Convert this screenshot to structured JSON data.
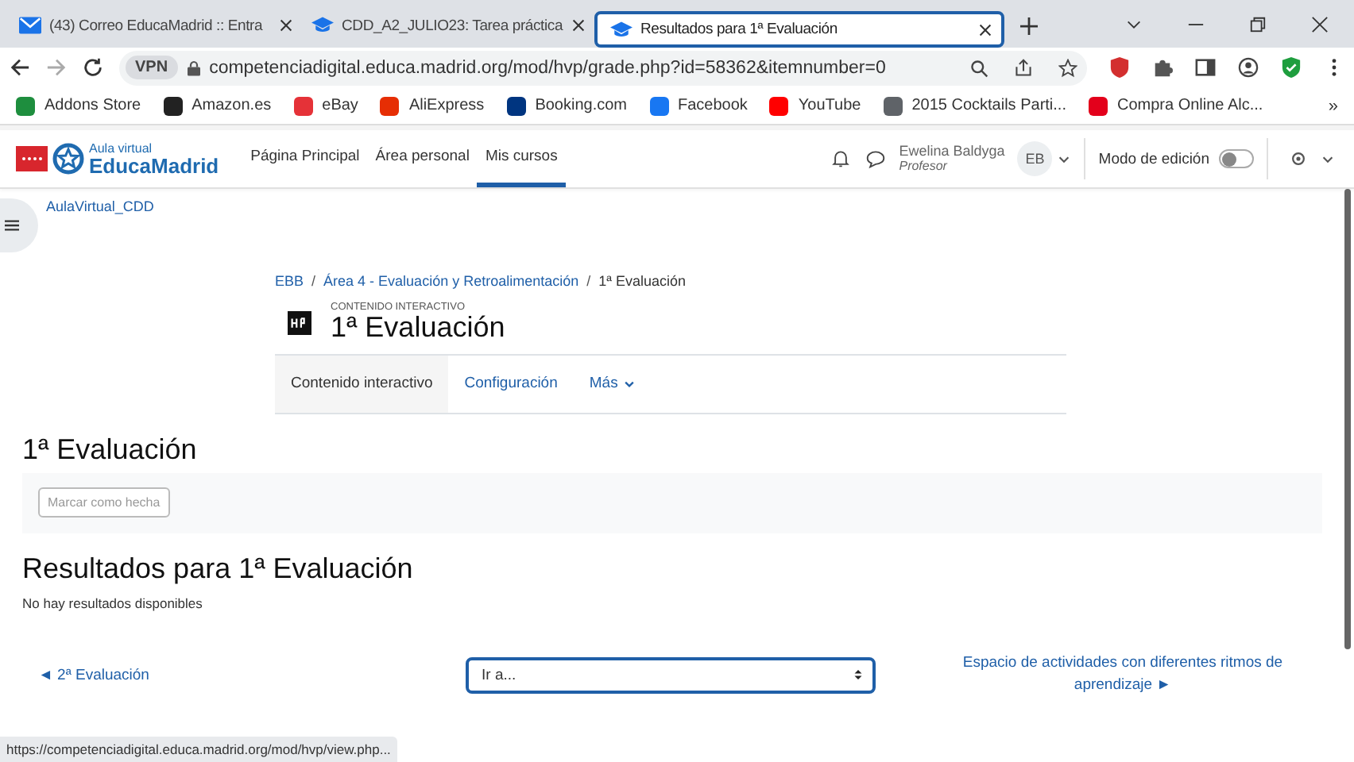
{
  "browser": {
    "tabs": [
      {
        "title": "(43) Correo EducaMadrid :: Entra",
        "selected": false
      },
      {
        "title": "CDD_A2_JULIO23: Tarea práctica",
        "selected": false
      },
      {
        "title": "Resultados para 1ª Evaluación",
        "selected": true
      }
    ],
    "vpn": "VPN",
    "url": "competenciadigital.educa.madrid.org/mod/hvp/grade.php?id=58362&itemnumber=0",
    "bookmarks": [
      {
        "label": "Addons Store",
        "color": "#1e8e3e"
      },
      {
        "label": "Amazon.es",
        "color": "#222222"
      },
      {
        "label": "eBay",
        "color": "#e53238"
      },
      {
        "label": "AliExpress",
        "color": "#e62e04"
      },
      {
        "label": "Booking.com",
        "color": "#003580"
      },
      {
        "label": "Facebook",
        "color": "#1877f2"
      },
      {
        "label": "YouTube",
        "color": "#ff0000"
      },
      {
        "label": "2015 Cocktails Parti...",
        "color": "#5f6368"
      },
      {
        "label": "Compra Online Alc...",
        "color": "#e3001b"
      }
    ],
    "more": "»"
  },
  "site": {
    "logo_small": "Aula virtual",
    "logo_big": "EducaMadrid",
    "nav": [
      {
        "label": "Página Principal",
        "selected": false
      },
      {
        "label": "Área personal",
        "selected": false
      },
      {
        "label": "Mis cursos",
        "selected": true
      }
    ],
    "user_name": "Ewelina Baldyga",
    "user_role": "Profesor",
    "initials": "EB",
    "edit_mode": "Modo de edición",
    "edit_on": false
  },
  "course_link": "AulaVirtual_CDD",
  "breadcrumb_separator": "/",
  "breadcrumb": [
    "EBB",
    "Área 4 - Evaluación y Retroalimentación",
    "1ª Evaluación"
  ],
  "activity": {
    "type": "CONTENIDO INTERACTIVO",
    "title": "1ª Evaluación",
    "tabs": [
      {
        "label": "Contenido interactivo",
        "selected": true,
        "dropdown": false
      },
      {
        "label": "Configuración",
        "selected": false,
        "dropdown": false
      },
      {
        "label": "Más",
        "selected": false,
        "dropdown": true
      }
    ]
  },
  "section_title": "1ª Evaluación",
  "completion_button": {
    "label": "Marcar como hecha",
    "disabled": true
  },
  "results_title": "Resultados para 1ª Evaluación",
  "results_message": "No hay resultados disponibles",
  "prev_link": "◄ 2ª Evaluación",
  "jump": {
    "value": "Ir a..."
  },
  "next_link": "Espacio de actividades con diferentes ritmos de aprendizaje ►",
  "status_url": "https://competenciadigital.educa.madrid.org/mod/hvp/view.php..."
}
